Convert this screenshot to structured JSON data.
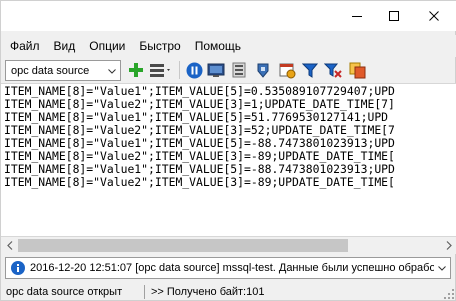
{
  "window": {
    "controls": {
      "minimize": "minimize",
      "maximize": "maximize",
      "close": "close"
    }
  },
  "menu": {
    "items": [
      "Файл",
      "Вид",
      "Опции",
      "Быстро",
      "Помощь"
    ]
  },
  "toolbar": {
    "source_select": "opc data source",
    "icons": [
      "add-icon",
      "list-options-icon",
      "pause-icon",
      "monitor-icon",
      "database-icon",
      "shield-icon",
      "schedule-icon",
      "filter-icon",
      "filter-clear-icon",
      "copy-icon"
    ]
  },
  "log": {
    "lines": [
      "ITEM_NAME[8]=\"Value1\";ITEM_VALUE[5]=0.535089107729407;UPD",
      "ITEM_NAME[8]=\"Value2\";ITEM_VALUE[3]=1;UPDATE_DATE_TIME[7]",
      "ITEM_NAME[8]=\"Value1\";ITEM_VALUE[5]=51.7769530127141;UPD",
      "ITEM_NAME[8]=\"Value2\";ITEM_VALUE[3]=52;UPDATE_DATE_TIME[7",
      "ITEM_NAME[8]=\"Value1\";ITEM_VALUE[5]=-88.7473801023913;UPD",
      "ITEM_NAME[8]=\"Value2\";ITEM_VALUE[3]=-89;UPDATE_DATE_TIME[",
      "ITEM_NAME[8]=\"Value1\";ITEM_VALUE[5]=-88.7473801023913;UPD",
      "ITEM_NAME[8]=\"Value2\";ITEM_VALUE[3]=-89;UPDATE_DATE_TIME["
    ]
  },
  "message": {
    "text": "2016-12-20 12:51:07 [opc data source] mssql-test. Данные были успешно обрабо"
  },
  "status": {
    "left": "opc data source открыт",
    "right": ">> Получено байт:101"
  },
  "colors": {
    "accent_blue": "#1a63c6",
    "add_green": "#2aa52a"
  }
}
